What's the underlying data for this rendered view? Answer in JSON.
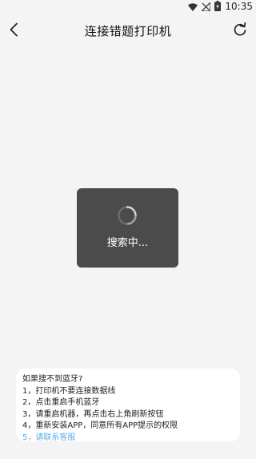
{
  "status_bar": {
    "time": "10:35"
  },
  "nav": {
    "title": "连接错题打印机"
  },
  "loading": {
    "text": "搜索中..."
  },
  "help": {
    "title": "如果搜不到蓝牙?",
    "items": [
      "1，打印机不要连接数据线",
      "2，点击重启手机蓝牙",
      "3，请重启机器，再点击右上角刷新按钮",
      "4，重新安装APP，同意所有APP提示的权限"
    ],
    "contact_link": "5，请联系客服"
  },
  "colors": {
    "background": "#f4f4f4",
    "loading_box": "#4b4b4b",
    "link": "#5aaee8",
    "card": "#ffffff"
  }
}
